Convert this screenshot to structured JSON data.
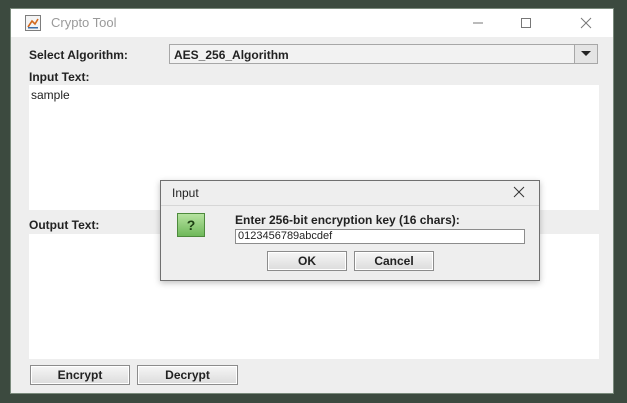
{
  "window": {
    "title": "Crypto Tool"
  },
  "algorithm": {
    "label": "Select Algorithm:",
    "selected": "AES_256_Algorithm"
  },
  "input": {
    "label": "Input Text:",
    "value": "sample"
  },
  "output": {
    "label": "Output Text:",
    "value": ""
  },
  "buttons": {
    "encrypt": "Encrypt",
    "decrypt": "Decrypt"
  },
  "dialog": {
    "title": "Input",
    "prompt": "Enter 256-bit encryption key (16 chars):",
    "key_value": "0123456789abcdef",
    "ok": "OK",
    "cancel": "Cancel"
  },
  "colors": {
    "background": "#3c4a3f",
    "window": "#eeeeee",
    "field": "#ffffff"
  }
}
